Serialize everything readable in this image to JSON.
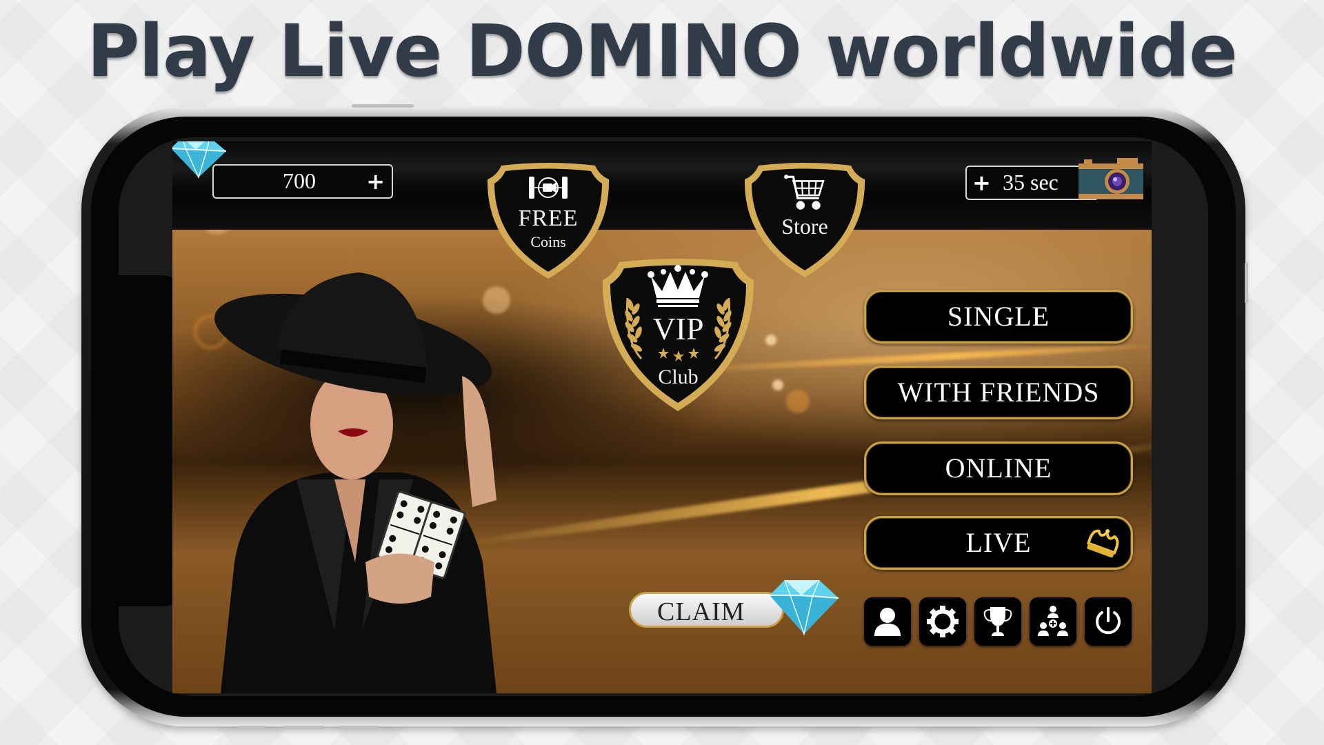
{
  "headline": "Play Live DOMINO worldwide",
  "top_bar": {
    "diamonds": {
      "icon": "diamond-icon",
      "value": "700",
      "add_label": "+"
    },
    "timer": {
      "add_label": "+",
      "value": "35 sec",
      "icon": "camera-icon"
    }
  },
  "shields": {
    "free_coins": {
      "icon": "video-reel-icon",
      "title": "FREE",
      "subtitle": "Coins"
    },
    "store": {
      "icon": "shopping-cart-icon",
      "title": "Store"
    },
    "vip": {
      "icon": "crown-icon",
      "title": "VIP",
      "subtitle": "Club",
      "stars": 3
    }
  },
  "menu": [
    {
      "label": "SINGLE"
    },
    {
      "label": "WITH FRIENDS"
    },
    {
      "label": "ONLINE"
    },
    {
      "label": "LIVE",
      "icon": "gold-crown-icon"
    }
  ],
  "icon_buttons": [
    {
      "name": "profile",
      "icon": "user-icon"
    },
    {
      "name": "settings",
      "icon": "gear-icon"
    },
    {
      "name": "leaderboard",
      "icon": "trophy-icon"
    },
    {
      "name": "invite-friends",
      "icon": "group-add-icon"
    },
    {
      "name": "power",
      "icon": "power-icon"
    }
  ],
  "claim": {
    "label": "CLAIM",
    "icon": "diamond-icon"
  },
  "colors": {
    "headline": "#323c48",
    "gold": "#c9a24a",
    "button_bg": "#000000",
    "diamond": "#5fd3ee"
  }
}
